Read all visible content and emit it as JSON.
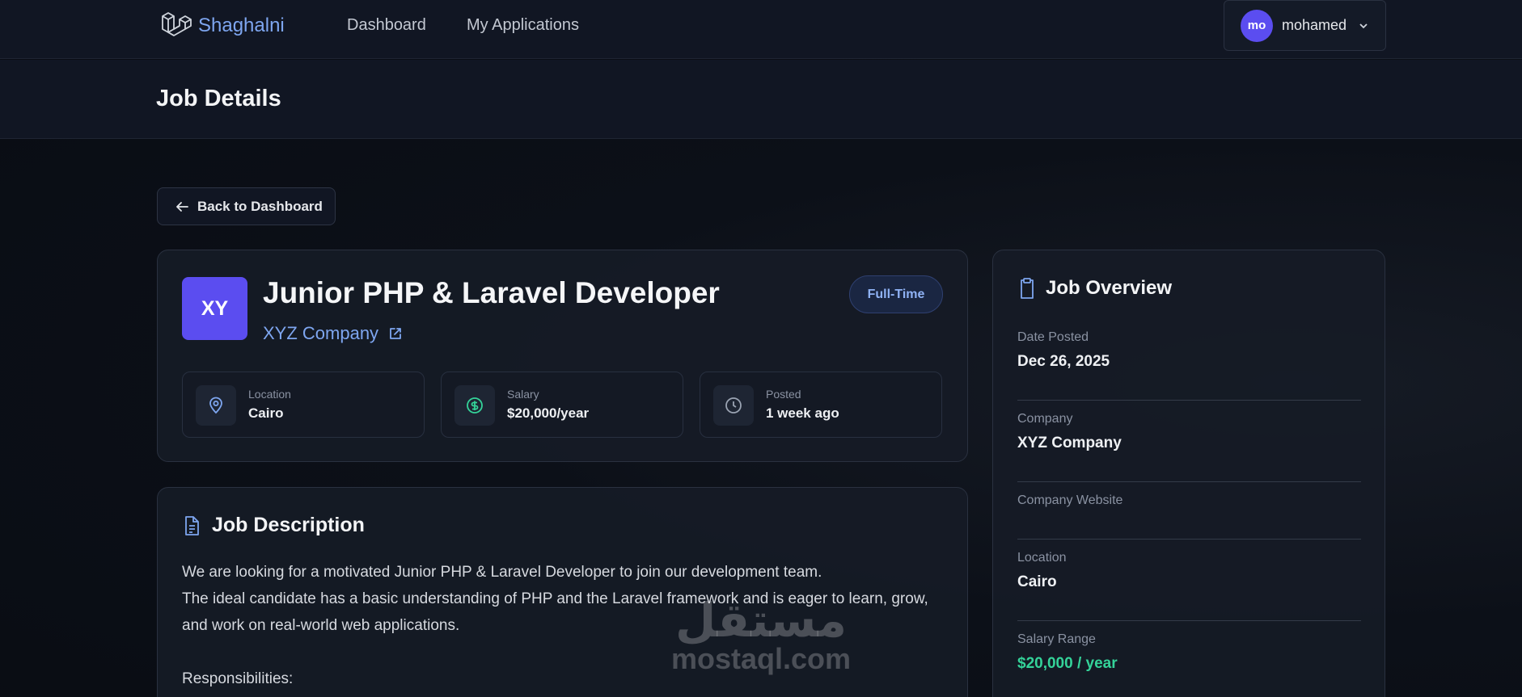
{
  "nav": {
    "brand": "Shaghalni",
    "links": [
      "Dashboard",
      "My Applications"
    ],
    "user": {
      "initials": "mo",
      "name": "mohamed"
    }
  },
  "header": {
    "title": "Job Details"
  },
  "back_button": {
    "label": "Back to Dashboard"
  },
  "job": {
    "logo_initials": "XY",
    "title": "Junior PHP & Laravel Developer",
    "company": "XYZ Company",
    "type": "Full-Time",
    "meta": [
      {
        "icon": "map-pin-icon",
        "label": "Location",
        "value": "Cairo"
      },
      {
        "icon": "dollar-circle-icon",
        "label": "Salary",
        "value": "$20,000/year"
      },
      {
        "icon": "clock-icon",
        "label": "Posted",
        "value": "1 week ago"
      }
    ]
  },
  "description": {
    "title": "Job Description",
    "paragraphs": [
      "We are looking for a motivated Junior PHP & Laravel Developer to join our development team.",
      "The ideal candidate has a basic understanding of PHP and the Laravel framework and is eager to learn, grow, and work on real-world web applications.",
      "Responsibilities:"
    ]
  },
  "overview": {
    "title": "Job Overview",
    "rows": [
      {
        "label": "Date Posted",
        "value": "Dec 26, 2025"
      },
      {
        "label": "Company",
        "value": "XYZ Company"
      },
      {
        "label": "Company Website",
        "value": ""
      },
      {
        "label": "Location",
        "value": "Cairo"
      },
      {
        "label": "Salary Range",
        "value": "$20,000 / year"
      }
    ]
  },
  "watermark": {
    "arabic": "مستقل",
    "latin": "mostaql.com"
  },
  "colors": {
    "accent": "#5b4df0",
    "link": "#7ea6f0",
    "salary": "#34d399",
    "background": "#0b0f17"
  }
}
